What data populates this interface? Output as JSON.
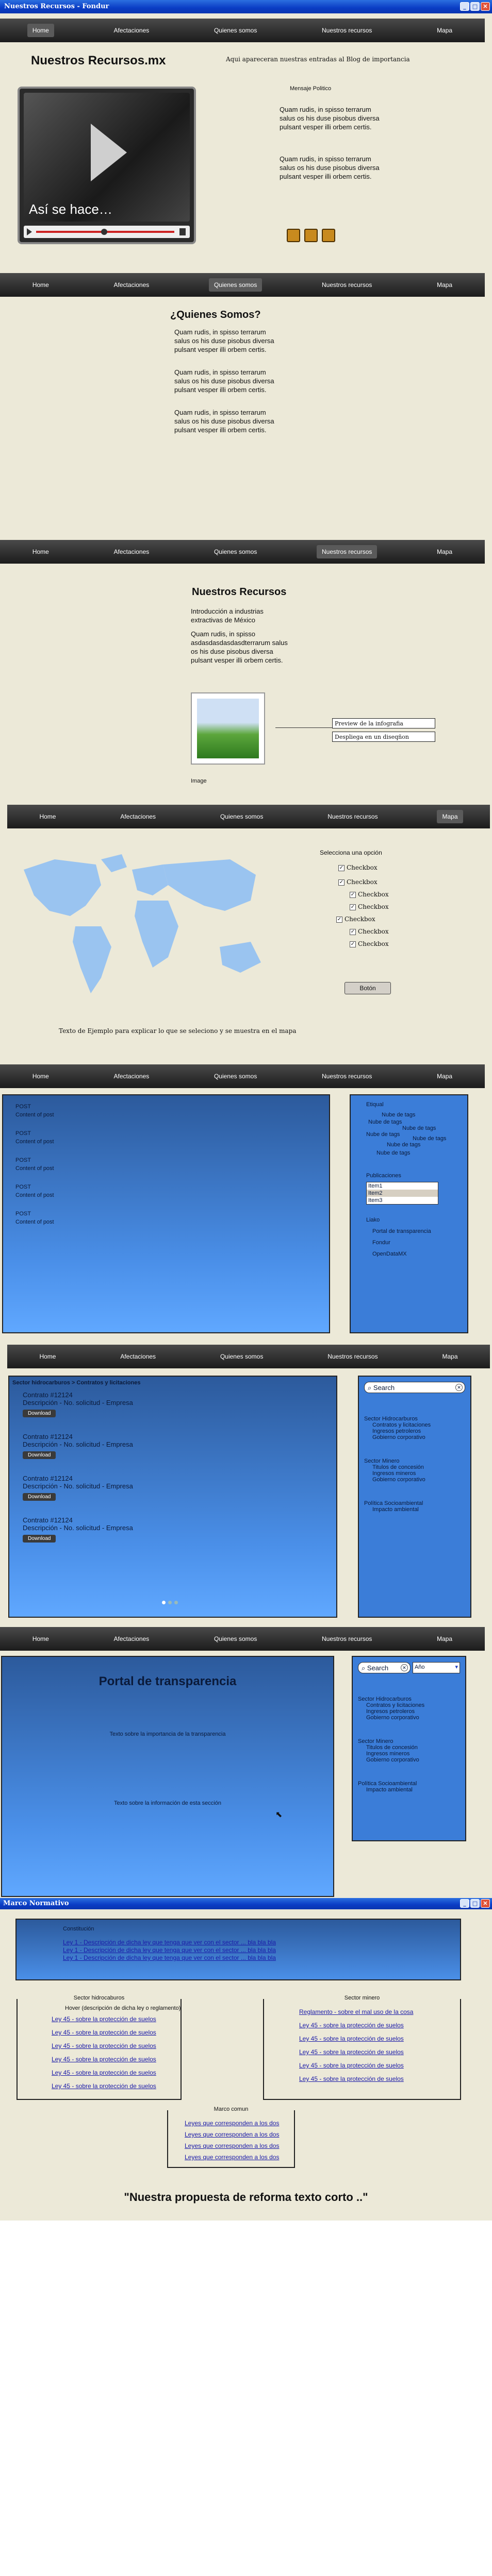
{
  "window": {
    "title": "Nuestros Recursos - Fondur",
    "title2": "Marco Normativo"
  },
  "nav": [
    "Home",
    "Afectaciones",
    "Quienes somos",
    "Nuestros recursos",
    "Mapa"
  ],
  "home": {
    "title": "Nuestros Recursos.mx",
    "blog_note": "Aqui apareceran nuestras entradas al Blog de importancia",
    "message_label": "Mensaje Politico",
    "video_caption": "Así se hace…",
    "para1": "Quam rudis, in spisso terrarum salus os his duse pisobus diversa pulsant vesper illi orbem certis.",
    "para2": "Quam rudis, in spisso terrarum salus os his duse pisobus diversa pulsant vesper illi orbem certis."
  },
  "about": {
    "title": "¿Quienes Somos?",
    "paras": [
      "Quam rudis, in spisso terrarum salus os his duse pisobus diversa pulsant vesper illi orbem certis.",
      "Quam rudis, in spisso terrarum salus os his duse pisobus diversa pulsant vesper illi orbem certis.",
      "Quam rudis, in spisso terrarum salus os his duse pisobus diversa pulsant vesper illi orbem certis."
    ]
  },
  "resources": {
    "title": "Nuestros Recursos",
    "intro": "Introducción a industrias extractivas de México",
    "para": "Quam rudis, in spisso asdasdasdasdasdterrarum salus os his duse pisobus diversa pulsant vesper illi orbem certis.",
    "image_label": "Image",
    "preview": "Preview de la infografia",
    "despliega": "Despliega en un diseqñon"
  },
  "map": {
    "select_label": "Selecciona una opción",
    "checks": [
      "Checkbox",
      "Checkbox",
      "Checkbox",
      "Checkbox",
      "Checkbox",
      "Checkbox",
      "Checkbox"
    ],
    "button": "Botón",
    "caption": "Texto de Ejemplo para explicar lo que se seleciono y se muestra en el mapa"
  },
  "blog": {
    "posts": [
      {
        "t": "POST",
        "c": "Content of post"
      },
      {
        "t": "POST",
        "c": "Content of post"
      },
      {
        "t": "POST",
        "c": "Content of post"
      },
      {
        "t": "POST",
        "c": "Content of post"
      },
      {
        "t": "POST",
        "c": "Content of post"
      }
    ],
    "tags_label": "Etiqual",
    "tags": [
      "Nube de tags",
      "Nube de tags",
      "Nube de tags",
      "Nube de tags",
      "Nube de tags",
      "Nube de tags",
      "Nube de tags"
    ],
    "pubs_label": "Publicaciones",
    "items": [
      "Item1",
      "Item2",
      "Item3"
    ],
    "links_label": "Liako",
    "links": [
      "Portal de transparencia",
      "Fondur",
      "OpenDataMX"
    ]
  },
  "contracts": {
    "header": "Sector hidrocarburos > Contratos y licitaciones",
    "items": [
      {
        "title": "Contrato #12124",
        "desc": "Descripción - No. solicitud - Empresa"
      },
      {
        "title": "Contrato #12124",
        "desc": "Descripción - No. solicitud - Empresa"
      },
      {
        "title": "Contrato #12124",
        "desc": "Descripción - No. solicitud - Empresa"
      },
      {
        "title": "Contrato #12124",
        "desc": "Descripción - No. solicitud - Empresa"
      }
    ],
    "download": "Download",
    "search_placeholder": "Search"
  },
  "sidebar_tree": {
    "s1": "Sector Hidrocarburos",
    "s1_items": [
      "Contratos y licitaciones",
      "Ingresos petroleros",
      "Gobierno corporativo"
    ],
    "s2": "Sector Minero",
    "s2_items": [
      "Titulos de concesión",
      "Ingresos mineros",
      "Gobierno corporativo"
    ],
    "s3": "Política Socioambiental",
    "s3_items": [
      "Impacto ambiental"
    ]
  },
  "transparency": {
    "title": "Portal de transparencia",
    "t1": "Texto sobre la importancia de la transparencia",
    "t2": "Texto sobre la información de esta sección",
    "year": "Año"
  },
  "normativo": {
    "constitucion": "Constitución",
    "const_links": [
      "Ley 1 - Descripción de dicha ley que tenga que ver con el sector ... bla bla bla",
      "Ley 1 - Descripción de dicha ley que tenga que ver con el sector ... bla bla bla",
      "Ley 1 - Descripción de dicha ley que tenga que ver con el sector ... bla bla bla"
    ],
    "hidro_label": "Sector hidrocaburos",
    "hidro_hover": "Hover (descripción de dicha ley o reglamento)",
    "hidro_links": [
      "Ley 45 - sobre la protección de suelos",
      "Ley 45 - sobre la protección de suelos",
      "Ley 45 - sobre la protección de suelos",
      "Ley 45 - sobre la protección de suelos",
      "Ley 45 - sobre la protección de suelos",
      "Ley 45 - sobre la protección de suelos"
    ],
    "minero_label": "Sector minero",
    "minero_links": [
      "Reglamento - sobre el mal uso de la cosa",
      "Ley 45 - sobre la protección de suelos",
      "Ley 45 - sobre la protección de suelos",
      "Ley 45 - sobre la protección de suelos",
      "Ley 45 - sobre la protección de suelos",
      "Ley 45 - sobre la protección de suelos"
    ],
    "comun_label": "Marco comun",
    "comun_links": [
      "Leyes que corresponden a los dos",
      "Leyes que corresponden a los dos",
      "Leyes que corresponden a los dos",
      "Leyes que corresponden a los dos"
    ],
    "reform": "\"Nuestra propuesta de reforma texto corto ..\""
  }
}
